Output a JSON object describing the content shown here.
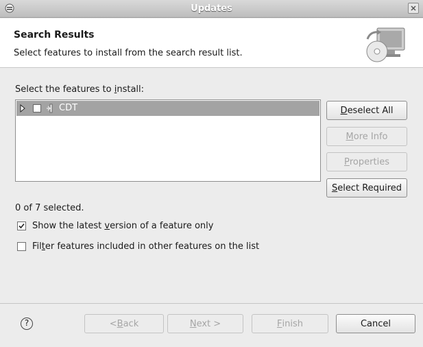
{
  "window": {
    "title": "Updates"
  },
  "header": {
    "title": "Search Results",
    "description": "Select features to install from the search result list."
  },
  "list": {
    "label_pre": "Select the features to ",
    "label_mnemonic": "i",
    "label_post": "nstall:",
    "items": [
      {
        "label": "CDT",
        "checked": false,
        "selected": true,
        "expanded": false
      }
    ]
  },
  "side_buttons": {
    "deselect_all": {
      "mnemonic": "D",
      "rest": "eselect All"
    },
    "more_info": {
      "mnemonic": "M",
      "rest": "ore Info"
    },
    "properties": {
      "mnemonic": "P",
      "rest": "roperties"
    },
    "select_required": {
      "mnemonic": "S",
      "rest": "elect Required"
    }
  },
  "status": "0 of 7 selected.",
  "options": {
    "latest_version": {
      "pre": "Show the latest ",
      "mnemonic": "v",
      "post": "ersion of a feature only",
      "checked": true
    },
    "filter_features": {
      "pre": "Fil",
      "mnemonic": "t",
      "post": "er features included in other features on the list",
      "checked": false
    }
  },
  "footer": {
    "back": {
      "pre": "< ",
      "mnemonic": "B",
      "post": "ack"
    },
    "next": {
      "mnemonic": "N",
      "post": "ext >"
    },
    "finish": {
      "mnemonic": "F",
      "post": "inish"
    },
    "cancel": "Cancel"
  },
  "icons": {
    "window": "window-menu-icon",
    "close": "close-icon",
    "header": "update-cd-monitor-icon",
    "help": "help-icon",
    "feature": "feature-icon"
  }
}
